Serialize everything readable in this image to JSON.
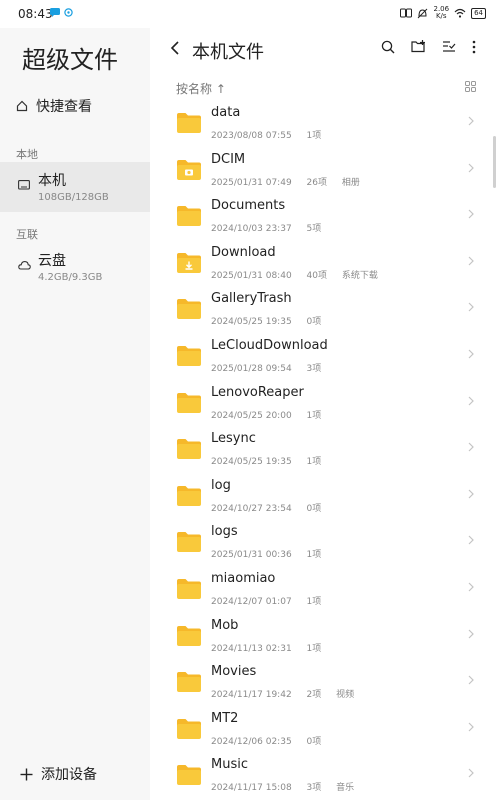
{
  "status": {
    "time": "08:43",
    "speed_value": "2.06",
    "speed_unit": "K/s",
    "battery": "64"
  },
  "sidebar": {
    "app_title": "超级文件",
    "quick_view": "快捷查看",
    "local_section": "本地",
    "local_device": {
      "name": "本机",
      "size": "108GB/128GB"
    },
    "connect_section": "互联",
    "cloud_device": {
      "name": "云盘",
      "size": "4.2GB/9.3GB"
    },
    "add_device": "添加设备"
  },
  "main": {
    "title": "本机文件",
    "sort_label": "按名称 ↑"
  },
  "folders": [
    {
      "name": "data",
      "date": "2023/08/08 07:55",
      "count": "1项",
      "tag": "",
      "variant": "plain"
    },
    {
      "name": "DCIM",
      "date": "2025/01/31 07:49",
      "count": "26项",
      "tag": "相册",
      "variant": "camera"
    },
    {
      "name": "Documents",
      "date": "2024/10/03 23:37",
      "count": "5项",
      "tag": "",
      "variant": "plain"
    },
    {
      "name": "Download",
      "date": "2025/01/31 08:40",
      "count": "40项",
      "tag": "系统下载",
      "variant": "download"
    },
    {
      "name": "GalleryTrash",
      "date": "2024/05/25 19:35",
      "count": "0项",
      "tag": "",
      "variant": "plain"
    },
    {
      "name": "LeCloudDownload",
      "date": "2025/01/28 09:54",
      "count": "3项",
      "tag": "",
      "variant": "plain"
    },
    {
      "name": "LenovoReaper",
      "date": "2024/05/25 20:00",
      "count": "1项",
      "tag": "",
      "variant": "plain"
    },
    {
      "name": "Lesync",
      "date": "2024/05/25 19:35",
      "count": "1项",
      "tag": "",
      "variant": "plain"
    },
    {
      "name": "log",
      "date": "2024/10/27 23:54",
      "count": "0项",
      "tag": "",
      "variant": "plain"
    },
    {
      "name": "logs",
      "date": "2025/01/31 00:36",
      "count": "1项",
      "tag": "",
      "variant": "plain"
    },
    {
      "name": "miaomiao",
      "date": "2024/12/07 01:07",
      "count": "1项",
      "tag": "",
      "variant": "plain"
    },
    {
      "name": "Mob",
      "date": "2024/11/13 02:31",
      "count": "1项",
      "tag": "",
      "variant": "plain"
    },
    {
      "name": "Movies",
      "date": "2024/11/17 19:42",
      "count": "2项",
      "tag": "视频",
      "variant": "plain"
    },
    {
      "name": "MT2",
      "date": "2024/12/06 02:35",
      "count": "0项",
      "tag": "",
      "variant": "plain"
    },
    {
      "name": "Music",
      "date": "2024/11/17 15:08",
      "count": "3项",
      "tag": "音乐",
      "variant": "plain"
    }
  ],
  "icons": {
    "folder_color": "#f9c93b",
    "folder_back_color": "#f6b82a"
  }
}
